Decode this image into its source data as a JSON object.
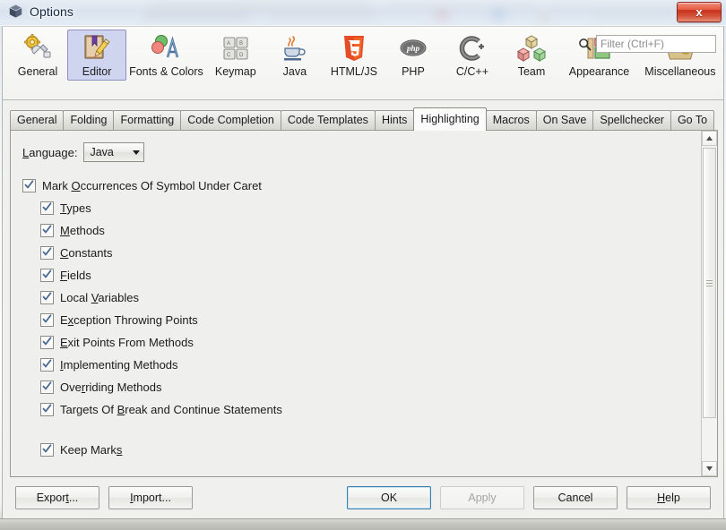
{
  "window": {
    "title": "Options",
    "icon": "cube-icon",
    "close_label": "x"
  },
  "categories": [
    {
      "label": "General",
      "icon": "gear-wrench-icon",
      "selected": false
    },
    {
      "label": "Editor",
      "icon": "notebook-pencil-icon",
      "selected": true
    },
    {
      "label": "Fonts & Colors",
      "icon": "palette-letter-a-icon",
      "selected": false
    },
    {
      "label": "Keymap",
      "icon": "keyboard-keys-icon",
      "selected": false
    },
    {
      "label": "Java",
      "icon": "java-coffee-cup-icon",
      "selected": false
    },
    {
      "label": "HTML/JS",
      "icon": "html5-shield-icon",
      "selected": false
    },
    {
      "label": "PHP",
      "icon": "php-ellipse-icon",
      "selected": false
    },
    {
      "label": "C/C++",
      "icon": "c-plus-plus-icon",
      "selected": false
    },
    {
      "label": "Team",
      "icon": "colored-cubes-icon",
      "selected": false
    },
    {
      "label": "Appearance",
      "icon": "layout-panels-icon",
      "selected": false
    },
    {
      "label": "Miscellaneous",
      "icon": "documents-gear-icon",
      "selected": false
    }
  ],
  "filter": {
    "placeholder": "Filter (Ctrl+F)",
    "value": "",
    "icon": "search-icon"
  },
  "tabs": [
    {
      "label": "General",
      "selected": false
    },
    {
      "label": "Folding",
      "selected": false
    },
    {
      "label": "Formatting",
      "selected": false
    },
    {
      "label": "Code Completion",
      "selected": false
    },
    {
      "label": "Code Templates",
      "selected": false
    },
    {
      "label": "Hints",
      "selected": false
    },
    {
      "label": "Highlighting",
      "selected": true
    },
    {
      "label": "Macros",
      "selected": false
    },
    {
      "label": "On Save",
      "selected": false
    },
    {
      "label": "Spellchecker",
      "selected": false
    },
    {
      "label": "Go To",
      "selected": false
    }
  ],
  "panel": {
    "language_label": "Language:",
    "language_mnemonic": "L",
    "language_value": "Java",
    "options": [
      {
        "label": "Mark Occurrences Of Symbol Under Caret",
        "mnemonic": "O",
        "checked": true,
        "indent": false,
        "gap_above": false
      },
      {
        "label": "Types",
        "mnemonic": "T",
        "checked": true,
        "indent": true,
        "gap_above": false
      },
      {
        "label": "Methods",
        "mnemonic": "M",
        "checked": true,
        "indent": true,
        "gap_above": false
      },
      {
        "label": "Constants",
        "mnemonic": "C",
        "checked": true,
        "indent": true,
        "gap_above": false
      },
      {
        "label": "Fields",
        "mnemonic": "F",
        "checked": true,
        "indent": true,
        "gap_above": false
      },
      {
        "label": "Local Variables",
        "mnemonic": "V",
        "checked": true,
        "indent": true,
        "gap_above": false
      },
      {
        "label": "Exception Throwing Points",
        "mnemonic": "x",
        "checked": true,
        "indent": true,
        "gap_above": false
      },
      {
        "label": "Exit Points From Methods",
        "mnemonic": "E",
        "checked": true,
        "indent": true,
        "gap_above": false
      },
      {
        "label": "Implementing Methods",
        "mnemonic": "I",
        "checked": true,
        "indent": true,
        "gap_above": false
      },
      {
        "label": "Overriding Methods",
        "mnemonic": "r",
        "checked": true,
        "indent": true,
        "gap_above": false
      },
      {
        "label": "Targets Of Break and Continue Statements",
        "mnemonic": "B",
        "checked": true,
        "indent": true,
        "gap_above": false
      },
      {
        "label": "Keep Marks",
        "mnemonic": "s",
        "checked": true,
        "indent": true,
        "gap_above": true
      }
    ]
  },
  "scrollbar": {
    "up_icon": "triangle-up-icon",
    "down_icon": "triangle-down-icon"
  },
  "buttons": {
    "left": [
      {
        "label": "Export...",
        "mnemonic": "t",
        "state": "normal"
      },
      {
        "label": "Import...",
        "mnemonic": "I",
        "state": "normal"
      }
    ],
    "right": [
      {
        "label": "OK",
        "mnemonic": "",
        "state": "focused"
      },
      {
        "label": "Apply",
        "mnemonic": "",
        "state": "disabled"
      },
      {
        "label": "Cancel",
        "mnemonic": "",
        "state": "normal"
      },
      {
        "label": "Help",
        "mnemonic": "H",
        "state": "normal"
      }
    ]
  },
  "colors": {
    "selected_category_bg": "#cfd4ef",
    "selected_category_border": "#8f8fc0",
    "panel_bg": "#efefed",
    "focus_border": "#3c7fb1",
    "close_button": "#c8301c"
  }
}
